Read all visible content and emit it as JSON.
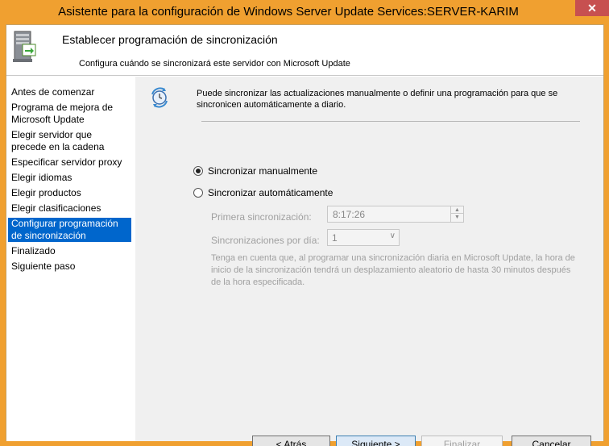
{
  "window": {
    "title": "Asistente para la configuración de Windows Server Update Services:SERVER-KARIM",
    "close_glyph": "✕",
    "accent_color": "#f0a030"
  },
  "header": {
    "title": "Establecer programación de sincronización",
    "subtitle": "Configura cuándo se sincronizará este servidor con Microsoft Update",
    "icon": "server-sync-icon"
  },
  "nav": {
    "items": [
      {
        "label": "Antes de comenzar",
        "active": false
      },
      {
        "label": "Programa de mejora de Microsoft Update",
        "active": false
      },
      {
        "label": "Elegir servidor que precede en la cadena",
        "active": false
      },
      {
        "label": "Especificar servidor proxy",
        "active": false
      },
      {
        "label": "Elegir idiomas",
        "active": false
      },
      {
        "label": "Elegir productos",
        "active": false
      },
      {
        "label": "Elegir clasificaciones",
        "active": false
      },
      {
        "label": "Configurar programación de sincronización",
        "active": true
      },
      {
        "label": "Finalizado",
        "active": false
      },
      {
        "label": "Siguiente paso",
        "active": false
      }
    ]
  },
  "main": {
    "intro": "Puede sincronizar las actualizaciones manualmente o definir una programación para que se sincronicen automáticamente a diario.",
    "manual_label": "Sincronizar manualmente",
    "manual_checked": true,
    "auto_label": "Sincronizar automáticamente",
    "auto_checked": false,
    "first_sync_label": "Primera sincronización:",
    "first_sync_value": "8:17:26",
    "per_day_label": "Sincronizaciones por día:",
    "per_day_value": "1",
    "note": "Tenga en cuenta que, al programar una sincronización diaria en Microsoft Update, la hora de inicio de la sincronización tendrá un desplazamiento aleatorio de hasta 30 minutos después de la hora especificada."
  },
  "buttons": {
    "back": "< Atrás",
    "next": "Siguiente >",
    "finish": "Finalizar",
    "cancel": "Cancelar"
  }
}
